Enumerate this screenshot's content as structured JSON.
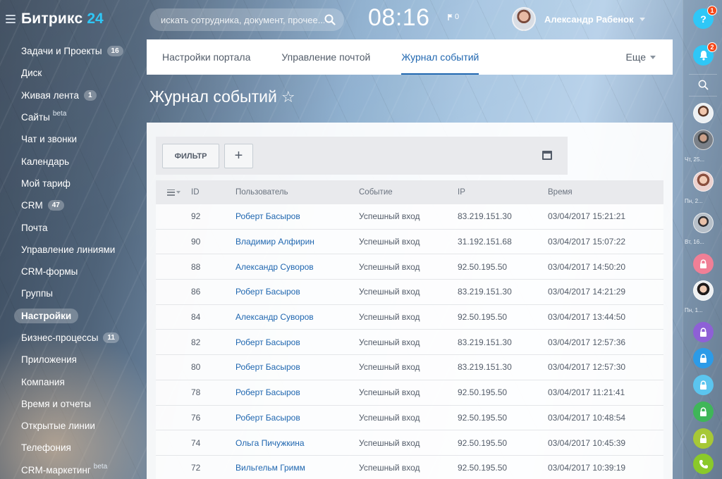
{
  "app": {
    "logo_name": "Битрикс",
    "logo_num": "24"
  },
  "search": {
    "placeholder": "искать сотрудника, документ, прочее..."
  },
  "header": {
    "clock": "08:16",
    "flag_count": "0",
    "user_name": "Александр Рабенок"
  },
  "sidebar": {
    "items": [
      {
        "label": "Задачи и Проекты",
        "counter": "16"
      },
      {
        "label": "Диск"
      },
      {
        "label": "Живая лента",
        "counter": "1"
      },
      {
        "label": "Сайты",
        "sup": "beta"
      },
      {
        "label": "Чат и звонки"
      },
      {
        "label": "Календарь"
      },
      {
        "label": "Мой тариф"
      },
      {
        "label": "CRM",
        "counter": "47"
      },
      {
        "label": "Почта"
      },
      {
        "label": "Управление линиями"
      },
      {
        "label": "CRM-формы"
      },
      {
        "label": "Группы"
      },
      {
        "label": "Настройки",
        "active": true
      },
      {
        "label": "Бизнес-процессы",
        "counter": "11"
      },
      {
        "label": "Приложения"
      },
      {
        "label": "Компания"
      },
      {
        "label": "Время и отчеты"
      },
      {
        "label": "Открытые линии"
      },
      {
        "label": "Телефония"
      },
      {
        "label": "CRM-маркетинг",
        "sup": "beta"
      }
    ]
  },
  "tabs": {
    "items": [
      "Настройки портала",
      "Управление почтой",
      "Журнал событий"
    ],
    "active_index": 2,
    "more": "Еще"
  },
  "page": {
    "title": "Журнал событий",
    "star": "☆"
  },
  "toolbar": {
    "filter_label": "ФИЛЬТР",
    "add_label": "+"
  },
  "table": {
    "columns": {
      "id": "ID",
      "user": "Пользователь",
      "event": "Событие",
      "ip": "IP",
      "time": "Время"
    },
    "rows": [
      {
        "id": "92",
        "user": "Роберт Басыров",
        "event": "Успешный вход",
        "ip": "83.219.151.30",
        "time": "03/04/2017 15:21:21"
      },
      {
        "id": "90",
        "user": "Владимир Алфирин",
        "event": "Успешный вход",
        "ip": "31.192.151.68",
        "time": "03/04/2017 15:07:22"
      },
      {
        "id": "88",
        "user": "Александр Суворов",
        "event": "Успешный вход",
        "ip": "92.50.195.50",
        "time": "03/04/2017 14:50:20"
      },
      {
        "id": "86",
        "user": "Роберт Басыров",
        "event": "Успешный вход",
        "ip": "83.219.151.30",
        "time": "03/04/2017 14:21:29"
      },
      {
        "id": "84",
        "user": "Александр Суворов",
        "event": "Успешный вход",
        "ip": "92.50.195.50",
        "time": "03/04/2017 13:44:50"
      },
      {
        "id": "82",
        "user": "Роберт Басыров",
        "event": "Успешный вход",
        "ip": "83.219.151.30",
        "time": "03/04/2017 12:57:36"
      },
      {
        "id": "80",
        "user": "Роберт Басыров",
        "event": "Успешный вход",
        "ip": "83.219.151.30",
        "time": "03/04/2017 12:57:30"
      },
      {
        "id": "78",
        "user": "Роберт Басыров",
        "event": "Успешный вход",
        "ip": "92.50.195.50",
        "time": "03/04/2017 11:21:41"
      },
      {
        "id": "76",
        "user": "Роберт Басыров",
        "event": "Успешный вход",
        "ip": "92.50.195.50",
        "time": "03/04/2017 10:48:54"
      },
      {
        "id": "74",
        "user": "Ольга Пичужкина",
        "event": "Успешный вход",
        "ip": "92.50.195.50",
        "time": "03/04/2017 10:45:39"
      },
      {
        "id": "72",
        "user": "Вильгельм Гримм",
        "event": "Успешный вход",
        "ip": "92.50.195.50",
        "time": "03/04/2017 10:39:19"
      }
    ]
  },
  "rightbar": {
    "help_label": "?",
    "help_badge": "1",
    "notify_badge": "2",
    "dates": [
      "Чт, 25...",
      "Пн, 2...",
      "Вт, 16...",
      "Пн, 1..."
    ],
    "colors": {
      "help": "#2fc7f7",
      "badge": "#f54819",
      "lock_pink": "#f07f96",
      "lock_purple": "#8e60d6",
      "lock_blue": "#2c9be8",
      "lock_cyan": "#5bc5ef",
      "lock_green": "#3fb658",
      "lock_lime": "#a7c836",
      "phone": "#8ac92a"
    }
  }
}
